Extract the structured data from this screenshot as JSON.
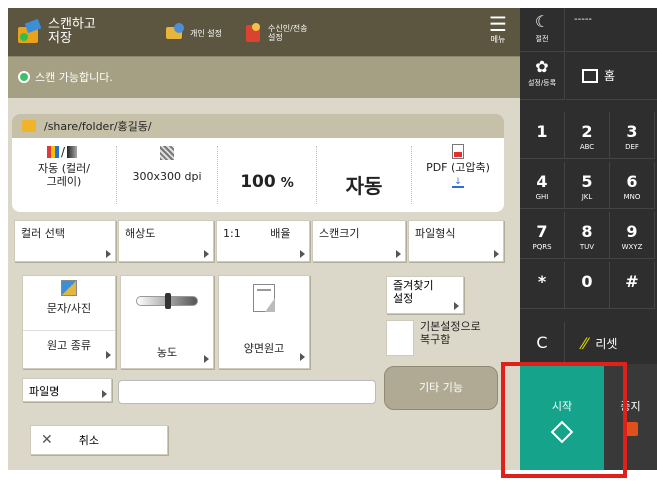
{
  "topbar": {
    "app_title_line1": "스캔하고",
    "app_title_line2": "저장",
    "personal_settings": "개인 설정",
    "recv_fwd_line1": "수신인/전송",
    "recv_fwd_line2": "설정",
    "menu": "메뉴"
  },
  "status": {
    "message": "스캔 가능합니다."
  },
  "card": {
    "path": "/share/folder/홍길동/",
    "color_mode_line1": "자동 (컬러/",
    "color_mode_line2": "그레이)",
    "resolution": "300x300 dpi",
    "zoom_value": "100",
    "zoom_unit": "%",
    "size": "자동",
    "file_format": "PDF (고압축)"
  },
  "setting_buttons": {
    "color_select": "컬러 선택",
    "resolution": "해상도",
    "ratio_left": "1:1",
    "ratio_right": "배율",
    "scan_size": "스캔크기",
    "file_type": "파일형식"
  },
  "lower": {
    "text_photo": "문자/사진",
    "doc_type": "원고 종류",
    "density": "농도",
    "duplex": "양면원고",
    "favorites_line1": "즐겨찾기",
    "favorites_line2": "설정",
    "default_line1": "기본설정으로",
    "default_line2": "복구함",
    "filename": "파일명",
    "filename_value": "",
    "other_functions": "기타 기능",
    "cancel": "취소"
  },
  "keypad": {
    "power": "절전",
    "dashes": "-----",
    "settings_register": "설정/등록",
    "home": "홈",
    "keys": [
      {
        "n": "1",
        "s": ""
      },
      {
        "n": "2",
        "s": "ABC"
      },
      {
        "n": "3",
        "s": "DEF"
      },
      {
        "n": "4",
        "s": "GHI"
      },
      {
        "n": "5",
        "s": "JKL"
      },
      {
        "n": "6",
        "s": "MNO"
      },
      {
        "n": "7",
        "s": "PQRS"
      },
      {
        "n": "8",
        "s": "TUV"
      },
      {
        "n": "9",
        "s": "WXYZ"
      },
      {
        "n": "*",
        "s": ""
      },
      {
        "n": "0",
        "s": ""
      },
      {
        "n": "#",
        "s": ""
      }
    ],
    "clear": "C",
    "reset": "리셋",
    "start": "시작",
    "stop": "중지"
  },
  "colors": {
    "topbar": "#5c5640",
    "statusbar": "#a59f84",
    "start": "#15a38b",
    "highlight": "#e0201b",
    "reset_icon": "#d9d100"
  }
}
